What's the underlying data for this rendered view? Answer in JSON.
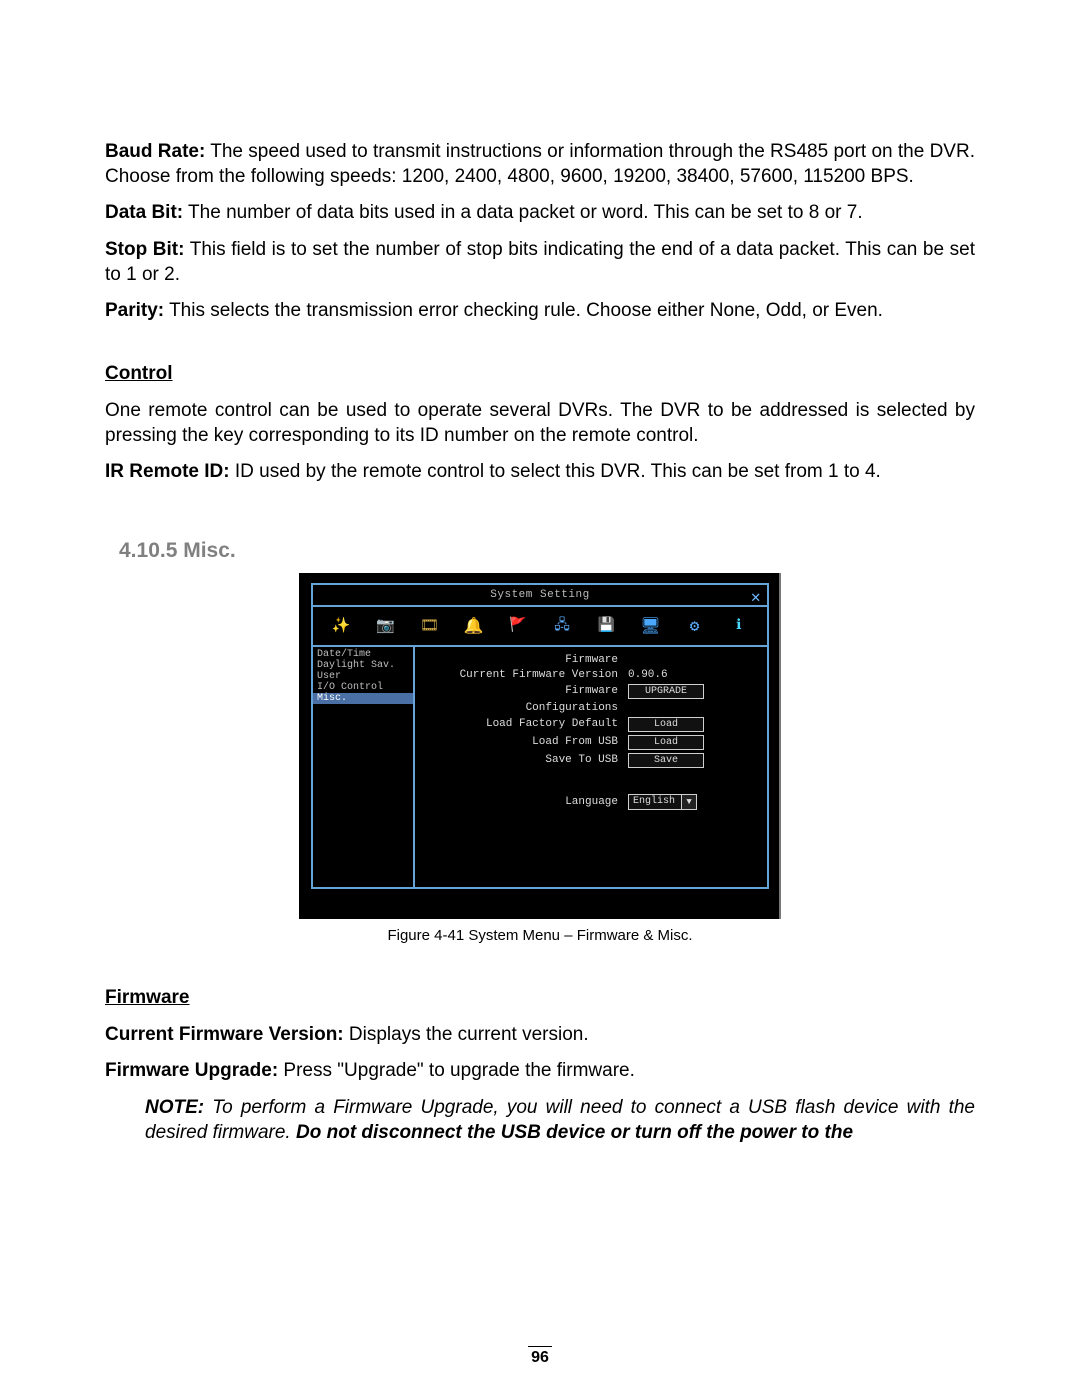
{
  "paragraphs": {
    "baud_rate_label": "Baud Rate:",
    "baud_rate_text": " The speed used to transmit instructions or information through the RS485 port on the DVR. Choose from the following speeds: 1200, 2400, 4800, 9600, 19200, 38400, 57600, 115200 BPS.",
    "data_bit_label": "Data Bit:",
    "data_bit_text": " The number of data bits used in a data packet or word. This can be set to 8 or 7.",
    "stop_bit_label": "Stop Bit:",
    "stop_bit_text": " This field is to set the number of stop bits indicating the end of a data packet. This can be set to 1 or 2.",
    "parity_label": "Parity:",
    "parity_text": " This selects the transmission error checking rule. Choose either None, Odd, or Even.",
    "control_heading": "Control",
    "control_text": "One remote control can be used to operate several DVRs. The DVR to be addressed is selected by pressing the key corresponding to its ID number on the remote control.",
    "ir_remote_label": "IR Remote ID:",
    "ir_remote_text": " ID used by the remote control to select this DVR. This can be set from 1 to 4.",
    "section_number": "4.10.5 Misc.",
    "firmware_heading": "Firmware",
    "cfv_label": "Current Firmware Version:",
    "cfv_text": " Displays the current version.",
    "fu_label": "Firmware Upgrade:",
    "fu_text": " Press \"Upgrade\" to upgrade the firmware.",
    "note_label": "NOTE:",
    "note_text_1": " To perform a Firmware Upgrade, you will need to connect a USB flash device with the desired firmware. ",
    "note_text_2": "Do not disconnect the USB device or turn off the power to the"
  },
  "figure": {
    "caption": "Figure 4-41 System Menu – Firmware & Misc.",
    "window_title": "System Setting",
    "close_glyph": "✕",
    "sidebar": [
      {
        "label": "Date/Time"
      },
      {
        "label": "Daylight Sav."
      },
      {
        "label": "User"
      },
      {
        "label": "I/O Control"
      },
      {
        "label": "Misc."
      }
    ],
    "content": {
      "firmware_header": "Firmware",
      "cfv_label": "Current Firmware Version",
      "cfv_value": "0.90.6",
      "firmware_label": "Firmware",
      "upgrade_btn": "UPGRADE",
      "config_header": "Configurations",
      "lfd_label": "Load Factory Default",
      "lfd_btn": "Load",
      "lfu_label": "Load From USB",
      "lfu_btn": "Load",
      "stu_label": "Save To USB",
      "stu_btn": "Save",
      "lang_label": "Language",
      "lang_value": "English"
    }
  },
  "page_number": "96"
}
